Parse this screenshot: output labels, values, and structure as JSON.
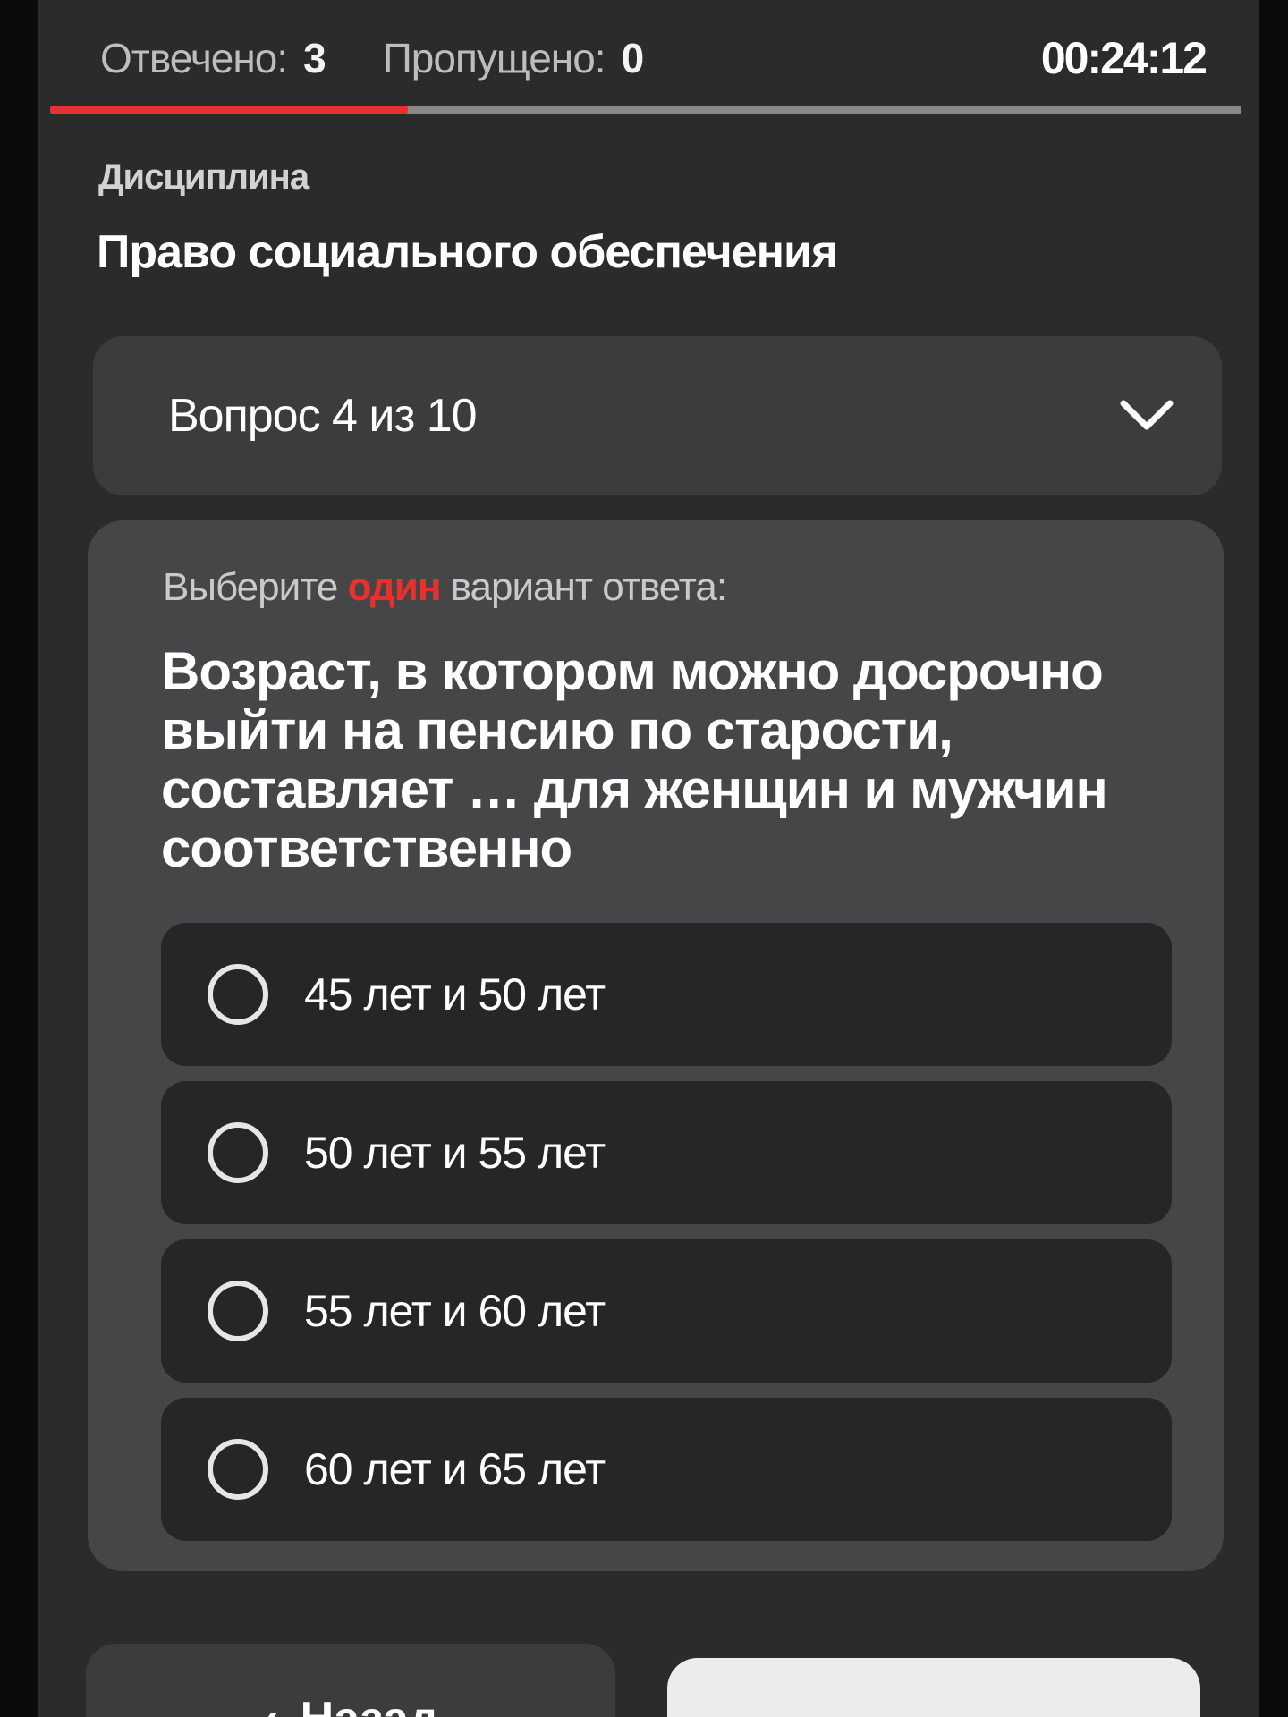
{
  "status": {
    "answered_label": "Отвечено:",
    "answered_value": "3",
    "skipped_label": "Пропущено:",
    "skipped_value": "0",
    "timer": "00:24:12",
    "progress_fraction": 0.3
  },
  "discipline": {
    "label": "Дисциплина",
    "title": "Право социального обеспечения"
  },
  "question_selector": {
    "label": "Вопрос 4 из 10",
    "icon": "chevron-down-icon"
  },
  "question": {
    "instruction_prefix": "Выберите",
    "instruction_accent": "один",
    "instruction_suffix": "вариант ответа:",
    "text": "Возраст, в котором можно досрочно выйти на пенсию по старости, составляет … для женщин и мужчин соответственно",
    "options": [
      {
        "label": "45 лет и 50 лет",
        "selected": false
      },
      {
        "label": "50 лет и 55 лет",
        "selected": false
      },
      {
        "label": "55 лет и 60 лет",
        "selected": false
      },
      {
        "label": "60 лет и 65 лет",
        "selected": false
      }
    ]
  },
  "navigation": {
    "back_label": "Назад",
    "back_icon": "chevron-left-icon"
  },
  "colors": {
    "accent": "#e8312c",
    "background": "#2b2b2c",
    "card": "#464648",
    "option": "#262627"
  }
}
